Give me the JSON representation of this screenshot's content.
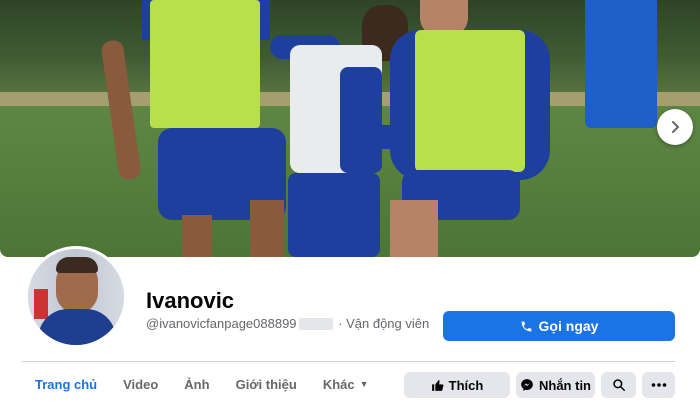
{
  "cover": {
    "next_icon": "chevron-right-icon"
  },
  "profile": {
    "name": "Ivanovic",
    "handle": "@ivanovicfanpage088899",
    "category": "Vận động viên"
  },
  "buttons": {
    "call_label": "Gọi ngay",
    "call_icon": "phone-icon",
    "like_label": "Thích",
    "like_icon": "thumbs-up-icon",
    "message_label": "Nhắn tin",
    "message_icon": "messenger-icon",
    "search_icon": "search-icon",
    "more_icon": "more-icon"
  },
  "tabs": [
    {
      "label": "Trang chủ",
      "active": true
    },
    {
      "label": "Video"
    },
    {
      "label": "Ảnh"
    },
    {
      "label": "Giới thiệu"
    },
    {
      "label": "Khác"
    }
  ],
  "colors": {
    "primary": "#1b74e4",
    "secondary_button": "#e4e6eb",
    "muted_text": "#65676b"
  }
}
